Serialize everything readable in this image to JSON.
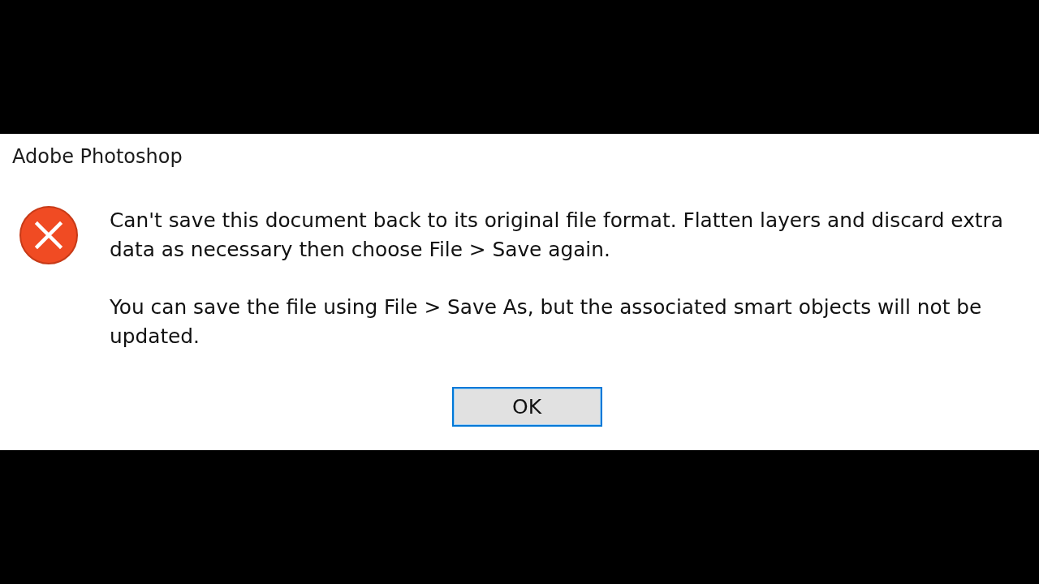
{
  "window": {
    "title": "Adobe Photoshop"
  },
  "message": {
    "kind": "error",
    "paragraphs": [
      "Can't save this document back to its original file format. Flatten layers and discard extra data as necessary then choose File > Save again.",
      "You can save the file using File > Save As, but the associated smart objects will not be updated."
    ]
  },
  "buttons": [
    {
      "label": "OK",
      "default": true
    }
  ]
}
